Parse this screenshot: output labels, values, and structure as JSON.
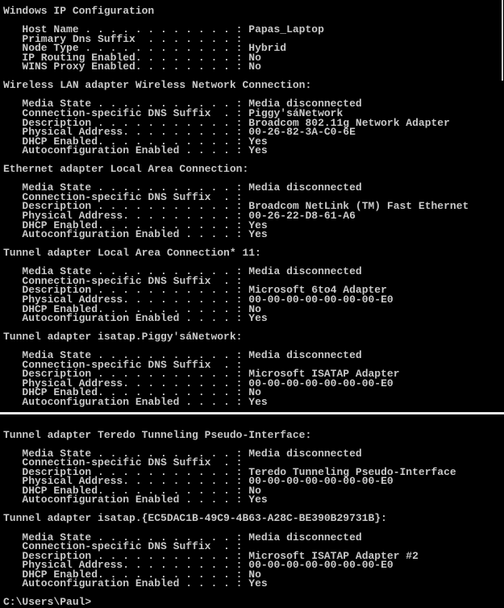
{
  "window": {
    "type": "command-prompt",
    "text_color": "#c8c8c8",
    "background": "#000000"
  },
  "top_panel": {
    "sections": [
      {
        "title": "Windows IP Configuration",
        "rows": [
          {
            "label": "Host Name . . . . . . . . . . . . :",
            "value": "Papas_Laptop"
          },
          {
            "label": "Primary Dns Suffix  . . . . . . . :",
            "value": ""
          },
          {
            "label": "Node Type . . . . . . . . . . . . :",
            "value": "Hybrid"
          },
          {
            "label": "IP Routing Enabled. . . . . . . . :",
            "value": "No"
          },
          {
            "label": "WINS Proxy Enabled. . . . . . . . :",
            "value": "No"
          }
        ]
      },
      {
        "title": "Wireless LAN adapter Wireless Network Connection:",
        "rows": [
          {
            "label": "Media State . . . . . . . . . . . :",
            "value": "Media disconnected"
          },
          {
            "label": "Connection-specific DNS Suffix  . :",
            "value": "Piggy'sáNetwork"
          },
          {
            "label": "Description . . . . . . . . . . . :",
            "value": "Broadcom 802.11g Network Adapter"
          },
          {
            "label": "Physical Address. . . . . . . . . :",
            "value": "00-26-82-3A-C0-6E"
          },
          {
            "label": "DHCP Enabled. . . . . . . . . . . :",
            "value": "Yes"
          },
          {
            "label": "Autoconfiguration Enabled . . . . :",
            "value": "Yes"
          }
        ]
      },
      {
        "title": "Ethernet adapter Local Area Connection:",
        "rows": [
          {
            "label": "Media State . . . . . . . . . . . :",
            "value": "Media disconnected"
          },
          {
            "label": "Connection-specific DNS Suffix  . :",
            "value": ""
          },
          {
            "label": "Description . . . . . . . . . . . :",
            "value": "Broadcom NetLink (TM) Fast Ethernet"
          },
          {
            "label": "Physical Address. . . . . . . . . :",
            "value": "00-26-22-D8-61-A6"
          },
          {
            "label": "DHCP Enabled. . . . . . . . . . . :",
            "value": "Yes"
          },
          {
            "label": "Autoconfiguration Enabled . . . . :",
            "value": "Yes"
          }
        ]
      },
      {
        "title": "Tunnel adapter Local Area Connection* 11:",
        "rows": [
          {
            "label": "Media State . . . . . . . . . . . :",
            "value": "Media disconnected"
          },
          {
            "label": "Connection-specific DNS Suffix  . :",
            "value": ""
          },
          {
            "label": "Description . . . . . . . . . . . :",
            "value": "Microsoft 6to4 Adapter"
          },
          {
            "label": "Physical Address. . . . . . . . . :",
            "value": "00-00-00-00-00-00-00-E0"
          },
          {
            "label": "DHCP Enabled. . . . . . . . . . . :",
            "value": "No"
          },
          {
            "label": "Autoconfiguration Enabled . . . . :",
            "value": "Yes"
          }
        ]
      },
      {
        "title": "Tunnel adapter isatap.Piggy'sáNetwork:",
        "rows": [
          {
            "label": "Media State . . . . . . . . . . . :",
            "value": "Media disconnected"
          },
          {
            "label": "Connection-specific DNS Suffix  . :",
            "value": ""
          },
          {
            "label": "Description . . . . . . . . . . . :",
            "value": "Microsoft ISATAP Adapter"
          },
          {
            "label": "Physical Address. . . . . . . . . :",
            "value": "00-00-00-00-00-00-00-E0"
          },
          {
            "label": "DHCP Enabled. . . . . . . . . . . :",
            "value": "No"
          },
          {
            "label": "Autoconfiguration Enabled . . . . :",
            "value": "Yes"
          }
        ]
      }
    ]
  },
  "bottom_panel": {
    "sections": [
      {
        "title": "Tunnel adapter Teredo Tunneling Pseudo-Interface:",
        "rows": [
          {
            "label": "Media State . . . . . . . . . . . :",
            "value": "Media disconnected"
          },
          {
            "label": "Connection-specific DNS Suffix  . :",
            "value": ""
          },
          {
            "label": "Description . . . . . . . . . . . :",
            "value": "Teredo Tunneling Pseudo-Interface"
          },
          {
            "label": "Physical Address. . . . . . . . . :",
            "value": "00-00-00-00-00-00-00-E0"
          },
          {
            "label": "DHCP Enabled. . . . . . . . . . . :",
            "value": "No"
          },
          {
            "label": "Autoconfiguration Enabled . . . . :",
            "value": "Yes"
          }
        ]
      },
      {
        "title": "Tunnel adapter isatap.{EC5DAC1B-49C9-4B63-A28C-BE390B29731B}:",
        "rows": [
          {
            "label": "Media State . . . . . . . . . . . :",
            "value": "Media disconnected"
          },
          {
            "label": "Connection-specific DNS Suffix  . :",
            "value": ""
          },
          {
            "label": "Description . . . . . . . . . . . :",
            "value": "Microsoft ISATAP Adapter #2"
          },
          {
            "label": "Physical Address. . . . . . . . . :",
            "value": "00-00-00-00-00-00-00-E0"
          },
          {
            "label": "DHCP Enabled. . . . . . . . . . . :",
            "value": "No"
          },
          {
            "label": "Autoconfiguration Enabled . . . . :",
            "value": "Yes"
          }
        ]
      }
    ],
    "prompt": "C:\\Users\\Paul>"
  }
}
